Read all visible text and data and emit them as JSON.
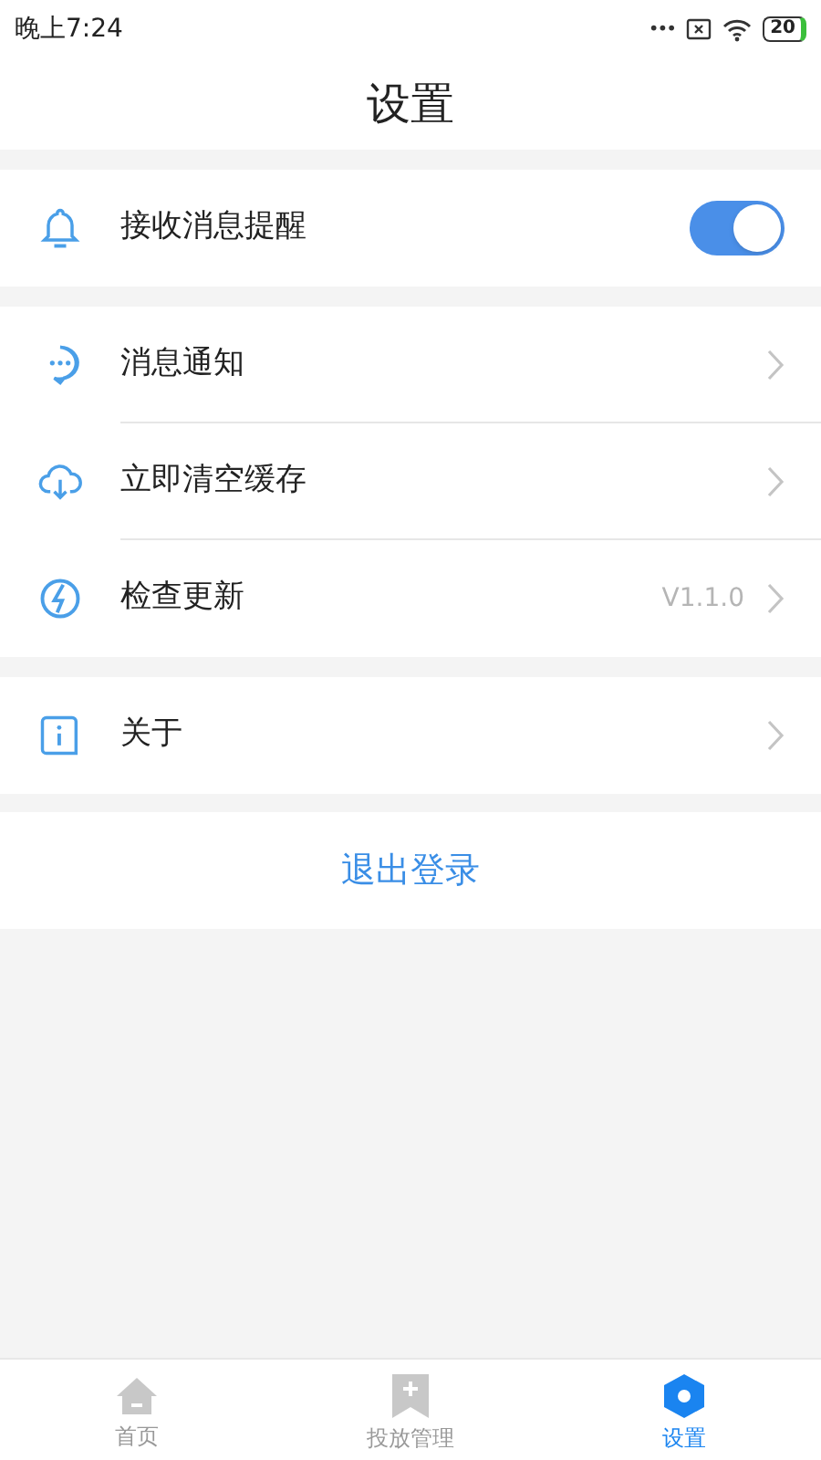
{
  "status_bar": {
    "time": "晚上7:24",
    "dots": "•••",
    "battery": "20"
  },
  "header": {
    "title": "设置"
  },
  "sections": [
    [
      {
        "kind": "toggle",
        "label": "接收消息提醒",
        "on": true
      }
    ],
    [
      {
        "kind": "link",
        "label": "消息通知"
      },
      {
        "kind": "link",
        "label": "立即清空缓存"
      },
      {
        "kind": "link",
        "label": "检查更新",
        "value": "V1.1.0"
      }
    ],
    [
      {
        "kind": "link",
        "label": "关于"
      }
    ]
  ],
  "logout": {
    "label": "退出登录"
  },
  "tab_bar": [
    {
      "label": "首页",
      "selected": false
    },
    {
      "label": "投放管理",
      "selected": false
    },
    {
      "label": "设置",
      "selected": true
    }
  ]
}
